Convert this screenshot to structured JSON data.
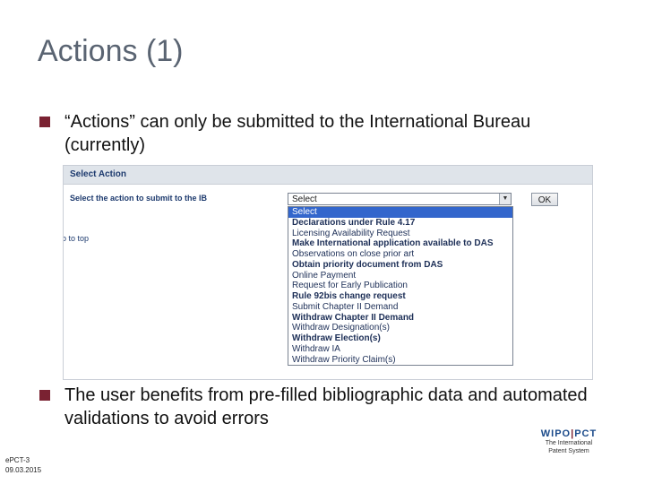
{
  "slide": {
    "title": "Actions (1)",
    "bullet1": "“Actions” can only be submitted to the International Bureau (currently)",
    "bullet2": "The user benefits from pre-filled bibliographic data and automated validations to avoid errors"
  },
  "screenshot": {
    "header": "Select Action",
    "prompt": "Select the action to submit to the IB",
    "goto_link": "o to top",
    "select_value": "Select",
    "ok_label": "OK",
    "options": [
      {
        "label": "Select",
        "selected": true,
        "bold": false
      },
      {
        "label": "Declarations under Rule 4.17",
        "selected": false,
        "bold": true
      },
      {
        "label": "Licensing Availability Request",
        "selected": false,
        "bold": false
      },
      {
        "label": "Make International application available to DAS",
        "selected": false,
        "bold": true
      },
      {
        "label": "Observations on close prior art",
        "selected": false,
        "bold": false
      },
      {
        "label": "Obtain priority document from DAS",
        "selected": false,
        "bold": true
      },
      {
        "label": "Online Payment",
        "selected": false,
        "bold": false
      },
      {
        "label": "Request for Early Publication",
        "selected": false,
        "bold": false
      },
      {
        "label": "Rule 92bis change request",
        "selected": false,
        "bold": true
      },
      {
        "label": "Submit Chapter II Demand",
        "selected": false,
        "bold": false
      },
      {
        "label": "Withdraw Chapter II Demand",
        "selected": false,
        "bold": true
      },
      {
        "label": "Withdraw Designation(s)",
        "selected": false,
        "bold": false
      },
      {
        "label": "Withdraw Election(s)",
        "selected": false,
        "bold": true
      },
      {
        "label": "Withdraw IA",
        "selected": false,
        "bold": false
      },
      {
        "label": "Withdraw Priority Claim(s)",
        "selected": false,
        "bold": false
      }
    ]
  },
  "logo": {
    "left": "WIPO",
    "sep": "|",
    "right": "PCT",
    "sub1": "The International",
    "sub2": "Patent System"
  },
  "footer": {
    "line1": "ePCT-3",
    "line2": "09.03.2015"
  },
  "colors": {
    "bullet": "#7a2232",
    "title": "#5a6472",
    "selection": "#3366cc"
  }
}
